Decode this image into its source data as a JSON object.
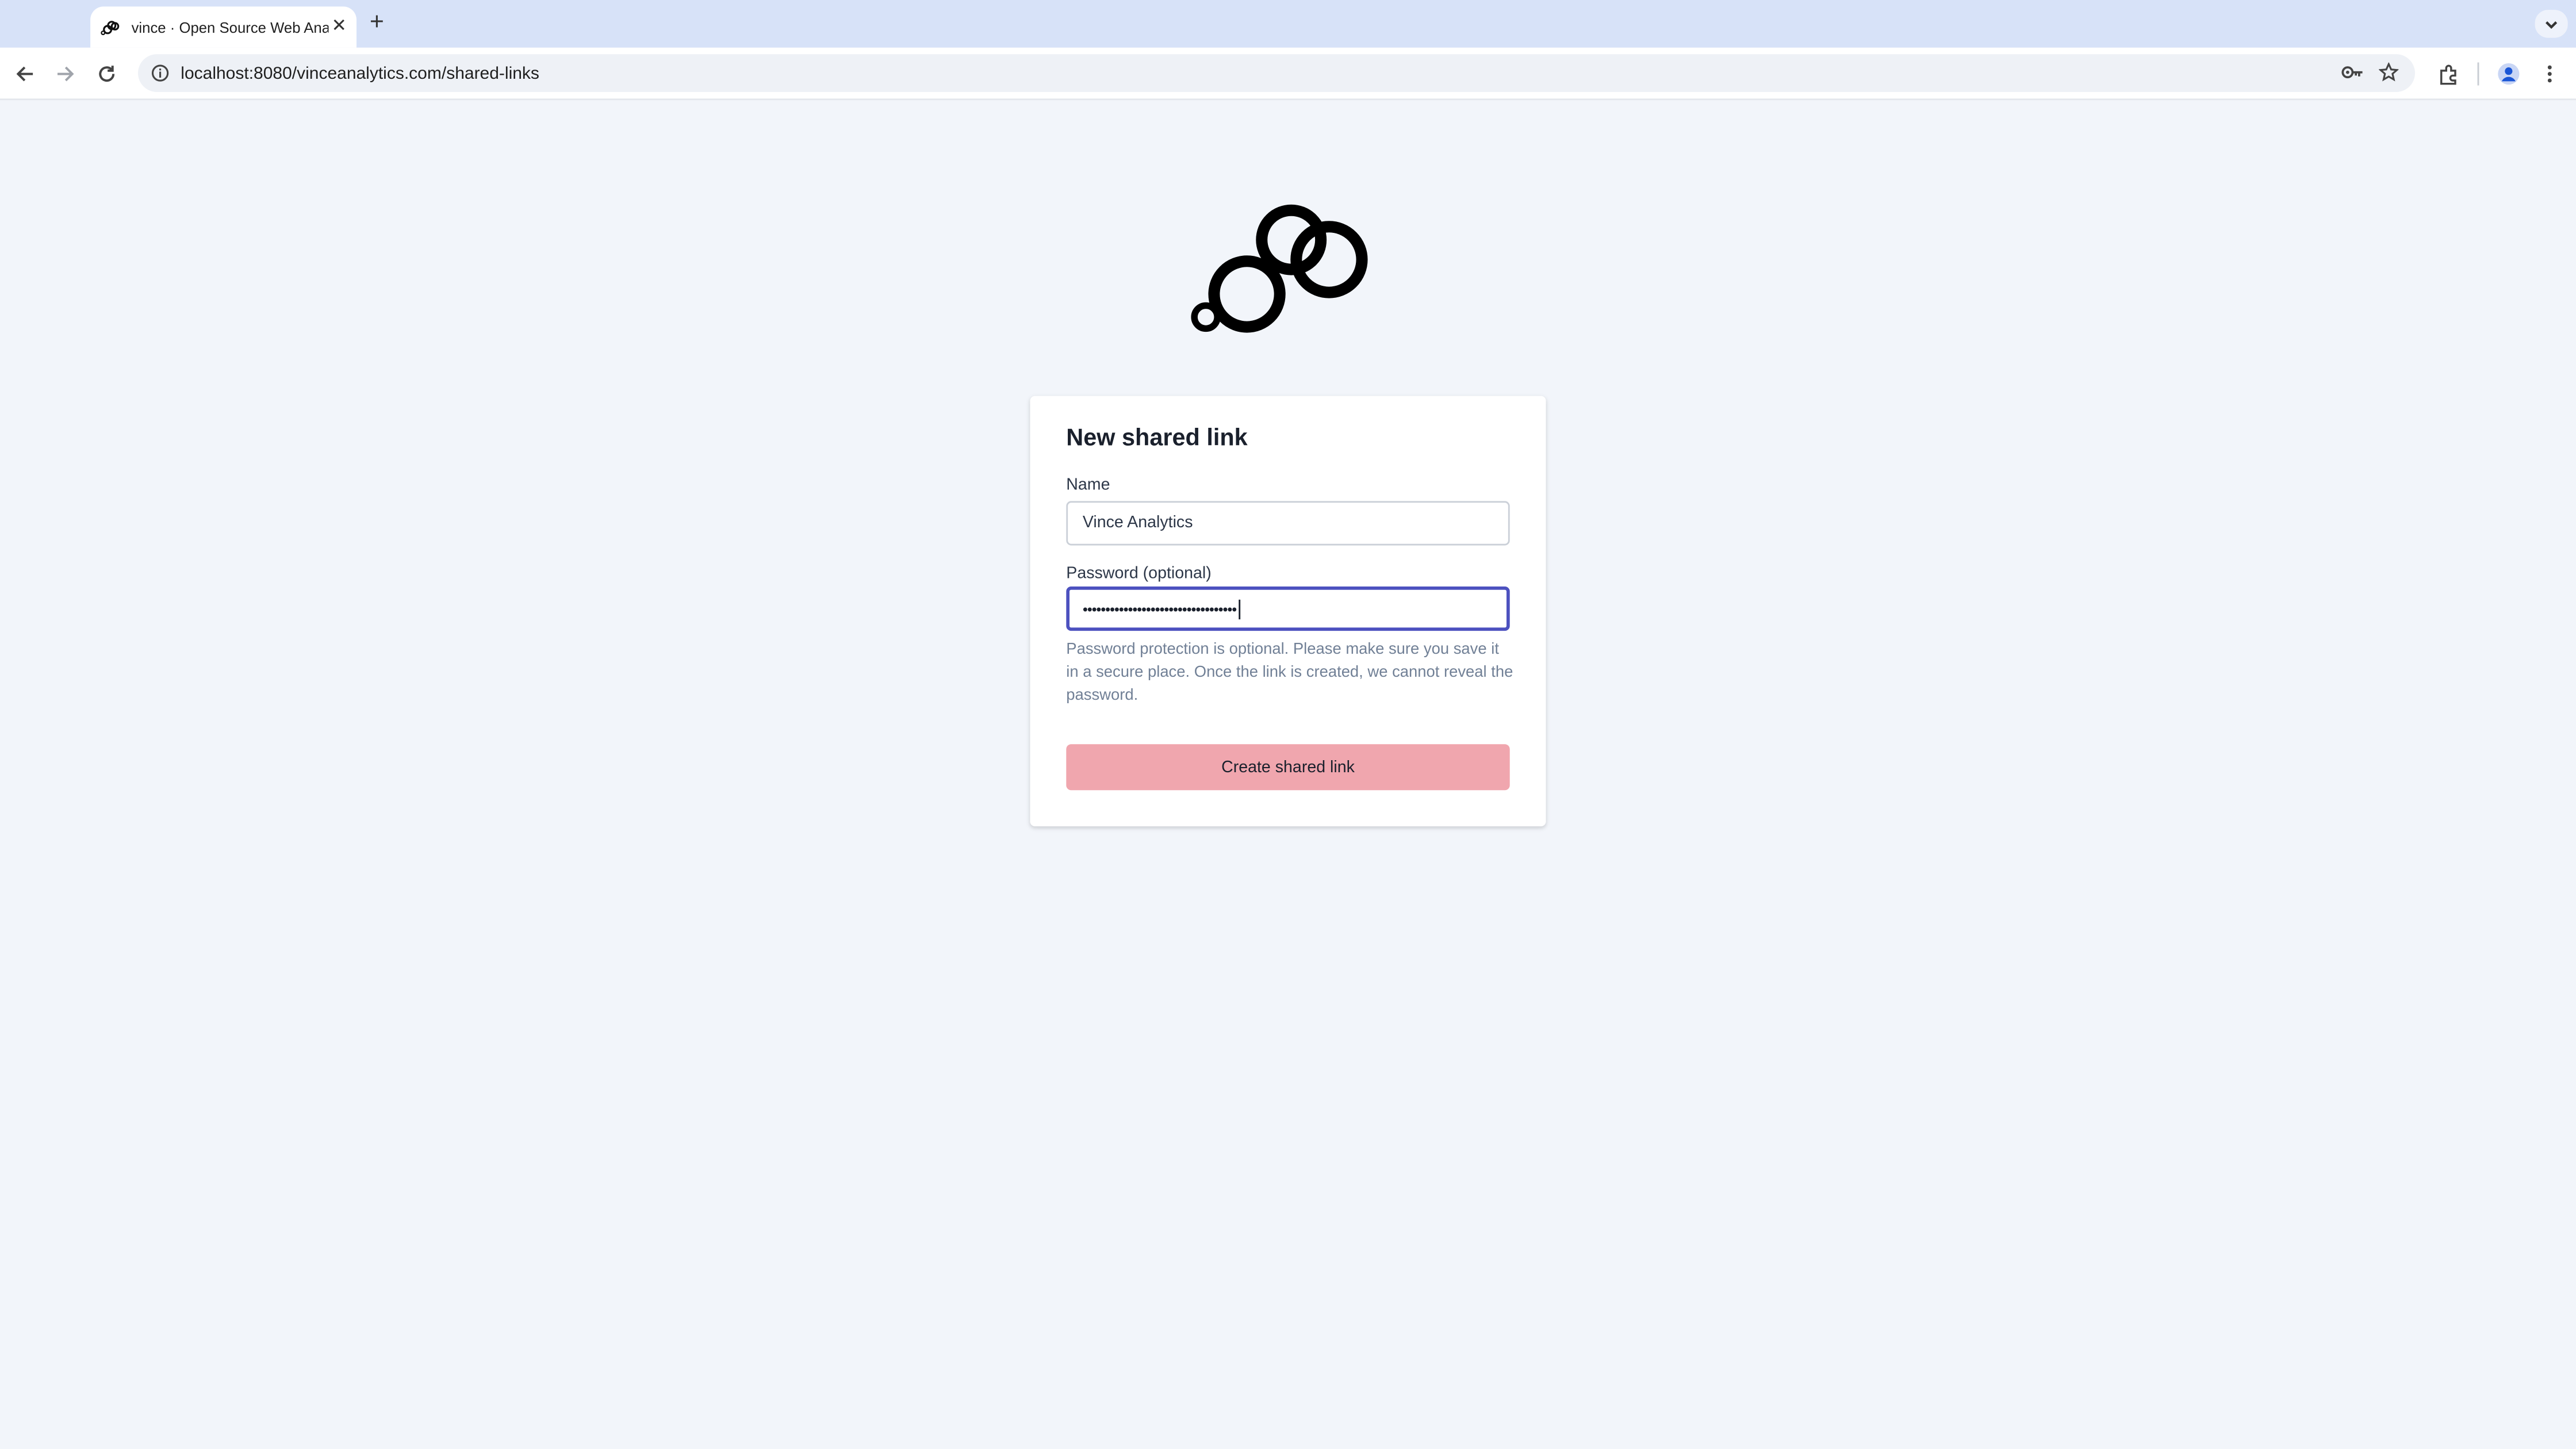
{
  "browser": {
    "tab_title": "vince · Open Source Web Analytics",
    "tab_close": "✕",
    "new_tab": "+",
    "url": "localhost:8080/vinceanalytics.com/shared-links"
  },
  "form": {
    "title": "New shared link",
    "name_label": "Name",
    "name_value": "Vince Analytics",
    "password_label": "Password (optional)",
    "password_masked": "••••••••••••••••••••••••••••••••••",
    "help_text": "Password protection is optional. Please make sure you save it in a secure place. Once the link is created, we cannot reveal the password.",
    "submit_label": "Create shared link"
  },
  "colors": {
    "page_bg": "#f2f5fa",
    "submit_bg": "#f0a6ae",
    "focus_border": "#4c51bf"
  },
  "icons": [
    "vince-logo",
    "back-arrow-icon",
    "forward-arrow-icon",
    "reload-icon",
    "site-info-icon",
    "password-key-icon",
    "star-icon",
    "extensions-icon",
    "profile-icon",
    "kebab-menu-icon",
    "tab-search-icon"
  ]
}
